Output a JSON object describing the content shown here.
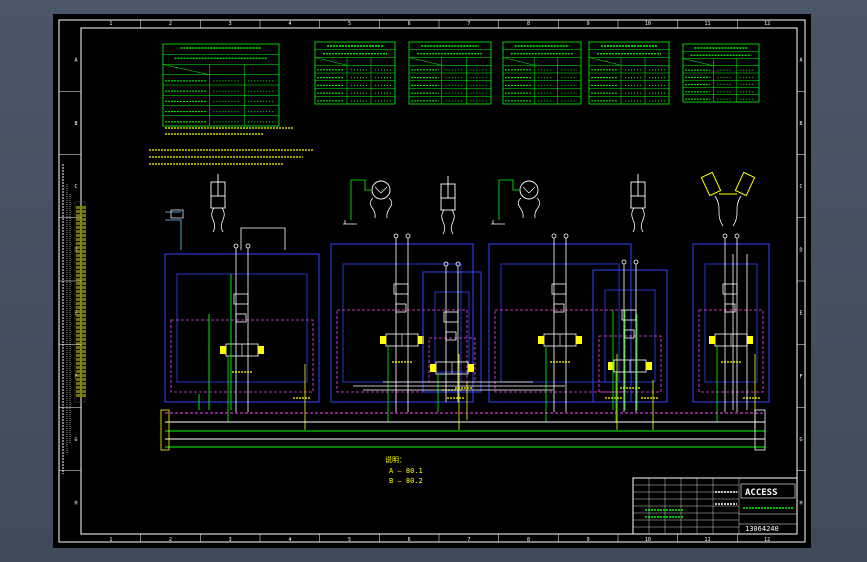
{
  "drawing": {
    "grid_columns": [
      "1",
      "2",
      "3",
      "4",
      "5",
      "6",
      "7",
      "8",
      "9",
      "10",
      "11",
      "12"
    ],
    "grid_rows": [
      "A",
      "B",
      "C",
      "D",
      "E",
      "F",
      "G",
      "H"
    ],
    "drawing_number": "13064240",
    "legend": {
      "heading": "说明：",
      "line_a": "A — 80.1",
      "line_b": "B — 80.2"
    },
    "company": "ACCESS",
    "colors": {
      "frame": "#ffffff",
      "cad_green": "#00ff00",
      "cad_yellow": "#ffff00",
      "cad_blue": "#3344ff",
      "cad_magenta": "#ff44ff",
      "cad_white": "#ffffff",
      "background": "#000000"
    }
  }
}
